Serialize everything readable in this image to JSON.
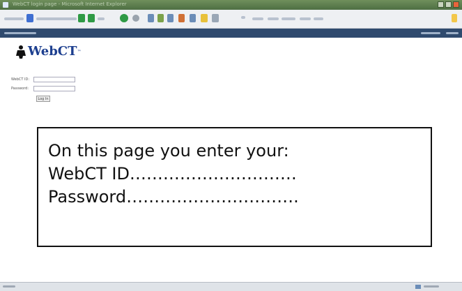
{
  "window": {
    "title_placeholder": "WebCT login page - Microsoft Internet Explorer"
  },
  "toolbar": {
    "icons": [
      "back-icon",
      "forward-icon",
      "stop-icon",
      "refresh-icon",
      "home-icon",
      "search-icon",
      "favorites-icon",
      "history-icon"
    ]
  },
  "header": {
    "logo_text": "WebCT",
    "logo_mark": "™"
  },
  "login": {
    "id_label": "WebCT ID:",
    "password_label": "Password:",
    "button_label": "Log In"
  },
  "callout": {
    "line1": "On this page you enter your:",
    "line2": "WebCT ID…………………………",
    "line3": "Password…………………………."
  },
  "colors": {
    "titlebar": "#4e6f43",
    "navbar": "#2f4a6e",
    "logo": "#1d3f8f"
  }
}
